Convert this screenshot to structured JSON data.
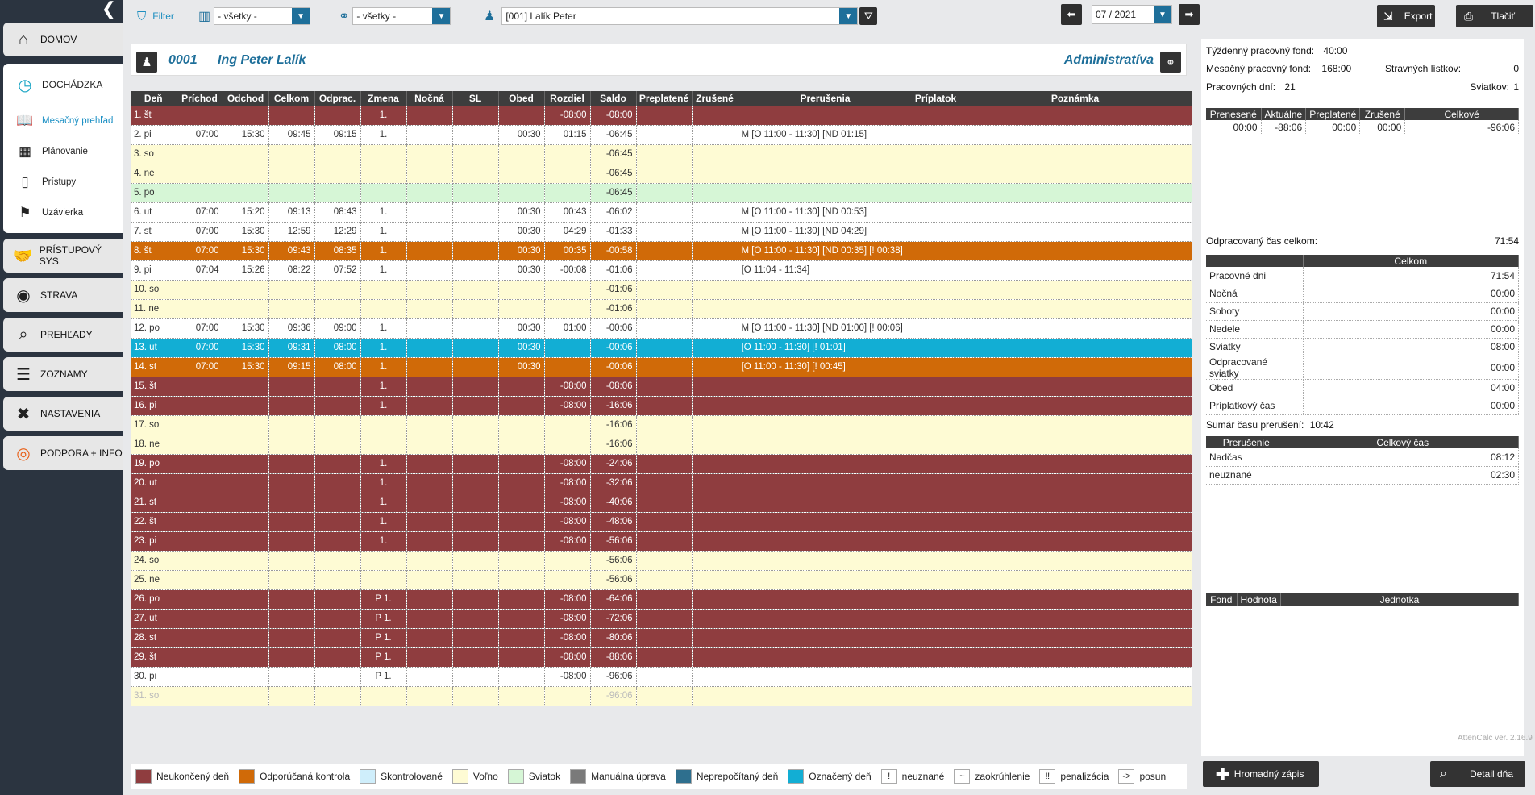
{
  "sidebar": {
    "items": [
      {
        "label": "DOMOV",
        "icon": "home-icon"
      },
      {
        "label": "DOCHÁDZKA",
        "icon": "clock-icon"
      },
      {
        "label": "PRÍSTUPOVÝ SYS.",
        "icon": "handshake-icon"
      },
      {
        "label": "STRAVA",
        "icon": "plate-icon"
      },
      {
        "label": "PREHĽADY",
        "icon": "search-report-icon"
      },
      {
        "label": "ZOZNAMY",
        "icon": "list-icon"
      },
      {
        "label": "NASTAVENIA",
        "icon": "tools-icon"
      },
      {
        "label": "PODPORA + INFO",
        "icon": "lifebuoy-icon"
      }
    ],
    "sub": [
      {
        "label": "Mesačný prehľad",
        "icon": "book-icon"
      },
      {
        "label": "Plánovanie",
        "icon": "calendar-icon"
      },
      {
        "label": "Prístupy",
        "icon": "door-icon"
      },
      {
        "label": "Uzávierka",
        "icon": "flag-icon"
      }
    ]
  },
  "toolbar": {
    "filter_label": "Filter",
    "dept_value": "- všetky -",
    "group_value": "- všetky -",
    "person_value": "[001] Lalík Peter",
    "period_value": "07 / 2021",
    "export_label": "Export",
    "print_label": "Tlačiť"
  },
  "employee": {
    "code": "0001",
    "name": "Ing Peter Lalík",
    "department": "Administratíva"
  },
  "grid": {
    "headers": [
      "Deň",
      "Príchod",
      "Odchod",
      "Celkom",
      "Odprac.",
      "Zmena",
      "Nočná",
      "SL",
      "Obed",
      "Rozdiel",
      "Saldo",
      "Preplatené",
      "Zrušené",
      "Prerušenia",
      "Príplatok",
      "Poznámka"
    ],
    "rows": [
      {
        "s": "red",
        "c": [
          "1. št",
          "",
          "",
          "",
          "",
          "1.",
          "",
          "",
          "",
          "-08:00",
          "-08:00",
          "",
          "",
          "",
          "",
          ""
        ]
      },
      {
        "s": "white",
        "c": [
          "2. pi",
          "07:00",
          "15:30",
          "09:45",
          "09:15",
          "1.",
          "",
          "",
          "00:30",
          "01:15",
          "-06:45",
          "",
          "",
          "M [O 11:00 - 11:30] [ND 01:15]",
          "",
          ""
        ]
      },
      {
        "s": "yel",
        "c": [
          "3. so",
          "",
          "",
          "",
          "",
          "",
          "",
          "",
          "",
          "",
          "-06:45",
          "",
          "",
          "",
          "",
          ""
        ]
      },
      {
        "s": "yel",
        "c": [
          "4. ne",
          "",
          "",
          "",
          "",
          "",
          "",
          "",
          "",
          "",
          "-06:45",
          "",
          "",
          "",
          "",
          ""
        ]
      },
      {
        "s": "green",
        "c": [
          "5. po",
          "",
          "",
          "",
          "",
          "",
          "",
          "",
          "",
          "",
          "-06:45",
          "",
          "",
          "",
          "",
          ""
        ]
      },
      {
        "s": "white",
        "c": [
          "6. ut",
          "07:00",
          "15:20",
          "09:13",
          "08:43",
          "1.",
          "",
          "",
          "00:30",
          "00:43",
          "-06:02",
          "",
          "",
          "M [O 11:00 - 11:30] [ND 00:53]",
          "",
          ""
        ]
      },
      {
        "s": "white",
        "c": [
          "7. st",
          "07:00",
          "15:30",
          "12:59",
          "12:29",
          "1.",
          "",
          "",
          "00:30",
          "04:29",
          "-01:33",
          "",
          "",
          "M [O 11:00 - 11:30] [ND 04:29]",
          "",
          ""
        ]
      },
      {
        "s": "orange",
        "c": [
          "8. št",
          "07:00",
          "15:30",
          "09:43",
          "08:35",
          "1.",
          "",
          "",
          "00:30",
          "00:35",
          "-00:58",
          "",
          "",
          "M [O 11:00 - 11:30] [ND 00:35] [! 00:38]",
          "",
          ""
        ]
      },
      {
        "s": "white",
        "c": [
          "9. pi",
          "07:04",
          "15:26",
          "08:22",
          "07:52",
          "1.",
          "",
          "",
          "00:30",
          "-00:08",
          "-01:06",
          "",
          "",
          "[O 11:04 - 11:34]",
          "",
          ""
        ]
      },
      {
        "s": "yel",
        "c": [
          "10. so",
          "",
          "",
          "",
          "",
          "",
          "",
          "",
          "",
          "",
          "-01:06",
          "",
          "",
          "",
          "",
          ""
        ]
      },
      {
        "s": "yel",
        "c": [
          "11. ne",
          "",
          "",
          "",
          "",
          "",
          "",
          "",
          "",
          "",
          "-01:06",
          "",
          "",
          "",
          "",
          ""
        ]
      },
      {
        "s": "white",
        "c": [
          "12. po",
          "07:00",
          "15:30",
          "09:36",
          "09:00",
          "1.",
          "",
          "",
          "00:30",
          "01:00",
          "-00:06",
          "",
          "",
          "M [O 11:00 - 11:30] [ND 01:00] [! 00:06]",
          "",
          ""
        ]
      },
      {
        "s": "cyan",
        "c": [
          "13. ut",
          "07:00",
          "15:30",
          "09:31",
          "08:00",
          "1.",
          "",
          "",
          "00:30",
          "",
          "-00:06",
          "",
          "",
          "[O 11:00 - 11:30] [! 01:01]",
          "",
          ""
        ]
      },
      {
        "s": "orange",
        "c": [
          "14. st",
          "07:00",
          "15:30",
          "09:15",
          "08:00",
          "1.",
          "",
          "",
          "00:30",
          "",
          "-00:06",
          "",
          "",
          "[O 11:00 - 11:30] [! 00:45]",
          "",
          ""
        ]
      },
      {
        "s": "red",
        "c": [
          "15. št",
          "",
          "",
          "",
          "",
          "1.",
          "",
          "",
          "",
          "-08:00",
          "-08:06",
          "",
          "",
          "",
          "",
          ""
        ]
      },
      {
        "s": "red",
        "c": [
          "16. pi",
          "",
          "",
          "",
          "",
          "1.",
          "",
          "",
          "",
          "-08:00",
          "-16:06",
          "",
          "",
          "",
          "",
          ""
        ]
      },
      {
        "s": "yel",
        "c": [
          "17. so",
          "",
          "",
          "",
          "",
          "",
          "",
          "",
          "",
          "",
          "-16:06",
          "",
          "",
          "",
          "",
          ""
        ]
      },
      {
        "s": "yel",
        "c": [
          "18. ne",
          "",
          "",
          "",
          "",
          "",
          "",
          "",
          "",
          "",
          "-16:06",
          "",
          "",
          "",
          "",
          ""
        ]
      },
      {
        "s": "red",
        "c": [
          "19. po",
          "",
          "",
          "",
          "",
          "1.",
          "",
          "",
          "",
          "-08:00",
          "-24:06",
          "",
          "",
          "",
          "",
          ""
        ]
      },
      {
        "s": "red",
        "c": [
          "20. ut",
          "",
          "",
          "",
          "",
          "1.",
          "",
          "",
          "",
          "-08:00",
          "-32:06",
          "",
          "",
          "",
          "",
          ""
        ]
      },
      {
        "s": "red",
        "c": [
          "21. st",
          "",
          "",
          "",
          "",
          "1.",
          "",
          "",
          "",
          "-08:00",
          "-40:06",
          "",
          "",
          "",
          "",
          ""
        ]
      },
      {
        "s": "red",
        "c": [
          "22. št",
          "",
          "",
          "",
          "",
          "1.",
          "",
          "",
          "",
          "-08:00",
          "-48:06",
          "",
          "",
          "",
          "",
          ""
        ]
      },
      {
        "s": "red",
        "c": [
          "23. pi",
          "",
          "",
          "",
          "",
          "1.",
          "",
          "",
          "",
          "-08:00",
          "-56:06",
          "",
          "",
          "",
          "",
          ""
        ]
      },
      {
        "s": "yel",
        "c": [
          "24. so",
          "",
          "",
          "",
          "",
          "",
          "",
          "",
          "",
          "",
          "-56:06",
          "",
          "",
          "",
          "",
          ""
        ]
      },
      {
        "s": "yel",
        "c": [
          "25. ne",
          "",
          "",
          "",
          "",
          "",
          "",
          "",
          "",
          "",
          "-56:06",
          "",
          "",
          "",
          "",
          ""
        ]
      },
      {
        "s": "red",
        "c": [
          "26. po",
          "",
          "",
          "",
          "",
          "P 1.",
          "",
          "",
          "",
          "-08:00",
          "-64:06",
          "",
          "",
          "",
          "",
          ""
        ]
      },
      {
        "s": "red",
        "c": [
          "27. ut",
          "",
          "",
          "",
          "",
          "P 1.",
          "",
          "",
          "",
          "-08:00",
          "-72:06",
          "",
          "",
          "",
          "",
          ""
        ]
      },
      {
        "s": "red",
        "c": [
          "28. st",
          "",
          "",
          "",
          "",
          "P 1.",
          "",
          "",
          "",
          "-08:00",
          "-80:06",
          "",
          "",
          "",
          "",
          ""
        ]
      },
      {
        "s": "red",
        "c": [
          "29. št",
          "",
          "",
          "",
          "",
          "P 1.",
          "",
          "",
          "",
          "-08:00",
          "-88:06",
          "",
          "",
          "",
          "",
          ""
        ]
      },
      {
        "s": "white",
        "c": [
          "30. pi",
          "",
          "",
          "",
          "",
          "P 1.",
          "",
          "",
          "",
          "-08:00",
          "-96:06",
          "",
          "",
          "",
          "",
          ""
        ]
      },
      {
        "s": "faded",
        "c": [
          "31. so",
          "",
          "",
          "",
          "",
          "",
          "",
          "",
          "",
          "",
          "-96:06",
          "",
          "",
          "",
          "",
          ""
        ]
      }
    ]
  },
  "legend": [
    {
      "label": "Neukončený deň",
      "color": "#8f3d3f",
      "sym": ""
    },
    {
      "label": "Odporúčaná kontrola",
      "color": "#d06a08",
      "sym": ""
    },
    {
      "label": "Skontrolované",
      "color": "#cfeefb",
      "sym": ""
    },
    {
      "label": "Voľno",
      "color": "#fefbd4",
      "sym": ""
    },
    {
      "label": "Sviatok",
      "color": "#d6f6d6",
      "sym": ""
    },
    {
      "label": "Manuálna úprava",
      "color": "#7a7a7a",
      "sym": ""
    },
    {
      "label": "Neprepočítaný deň",
      "color": "#2e6f8e",
      "sym": ""
    },
    {
      "label": "Označený deň",
      "color": "#12aed4",
      "sym": ""
    },
    {
      "label": "neuznané",
      "color": "#ffffff",
      "sym": "!"
    },
    {
      "label": "zaokrúhlenie",
      "color": "#ffffff",
      "sym": "~"
    },
    {
      "label": "penalizácia",
      "color": "#ffffff",
      "sym": "‼"
    },
    {
      "label": "posun",
      "color": "#ffffff",
      "sym": "->"
    }
  ],
  "summary": {
    "weekly_fund_label": "Týždenný pracovný fond:",
    "weekly_fund_value": "40:00",
    "monthly_fund_label": "Mesačný pracovný fond:",
    "monthly_fund_value": "168:00",
    "meal_label": "Stravných lístkov:",
    "meal_value": "0",
    "workdays_label": "Pracovných dní:",
    "workdays_value": "21",
    "holidays_label": "Sviatkov:",
    "holidays_value": "1",
    "balance_headers": [
      "Prenesené",
      "Aktuálne",
      "Preplatené",
      "Zrušené",
      "Celkové"
    ],
    "balance_values": [
      "00:00",
      "-88:06",
      "00:00",
      "00:00",
      "-96:06"
    ],
    "worked_total_label": "Odpracovaný čas celkom:",
    "worked_total_value": "71:54",
    "worked_header": "Celkom",
    "worked_rows": [
      {
        "label": "Pracovné dni",
        "value": "71:54"
      },
      {
        "label": "Nočná",
        "value": "00:00"
      },
      {
        "label": "Soboty",
        "value": "00:00"
      },
      {
        "label": "Nedele",
        "value": "00:00"
      },
      {
        "label": "Sviatky",
        "value": "08:00"
      },
      {
        "label": "Odpracované sviatky",
        "value": "00:00"
      },
      {
        "label": "Obed",
        "value": "04:00"
      },
      {
        "label": "Príplatkový čas",
        "value": "00:00"
      }
    ],
    "interrupt_label": "Sumár času prerušení:",
    "interrupt_value": "10:42",
    "interrupt_headers": [
      "Prerušenie",
      "Celkový čas"
    ],
    "interrupt_rows": [
      {
        "label": "Nadčas",
        "value": "08:12"
      },
      {
        "label": "neuznané",
        "value": "02:30"
      }
    ],
    "fund_headers": [
      "Fond",
      "Hodnota",
      "Jednotka"
    ],
    "version": "AttenCalc ver. 2.16.9"
  },
  "buttons": {
    "bulk_entry": "Hromadný zápis",
    "day_detail": "Detail dňa"
  }
}
